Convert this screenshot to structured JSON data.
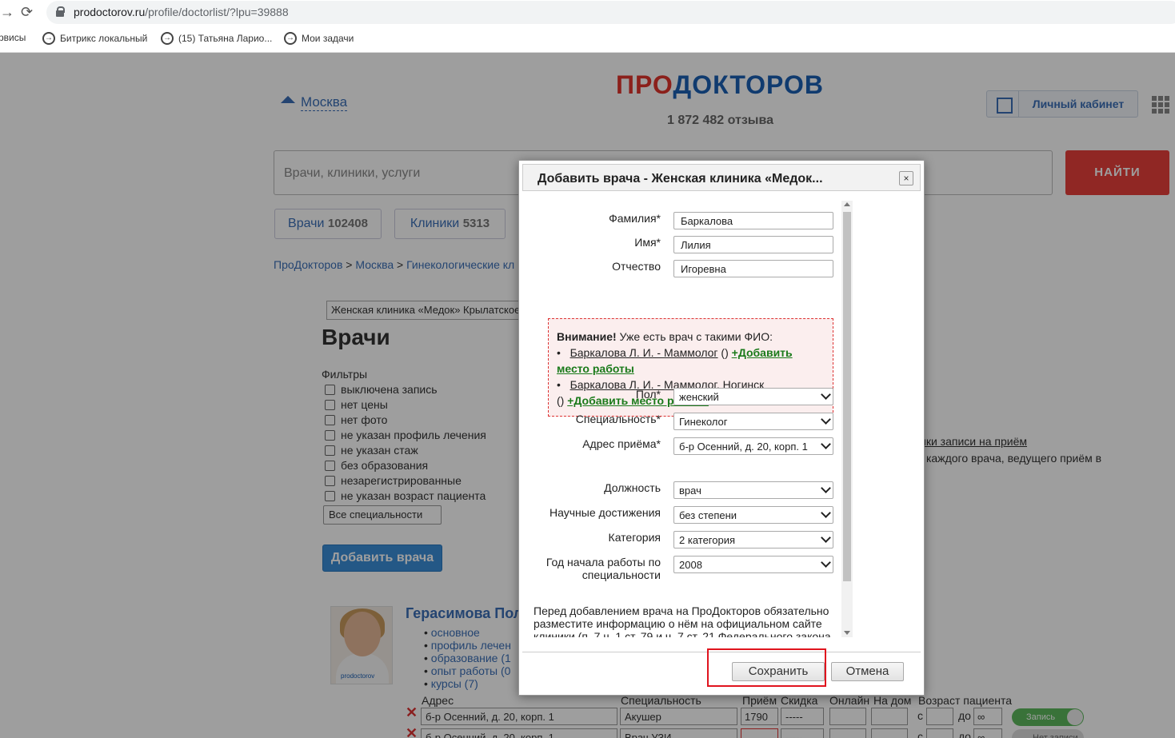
{
  "browser": {
    "url_domain": "prodoctorov.ru",
    "url_path": "/profile/doctorlist/?lpu=39888",
    "back_icon": "arrow-right-icon",
    "reload_icon": "reload-icon"
  },
  "bookmarks": [
    {
      "label": "рвисы"
    },
    {
      "label": "Битрикс локальный"
    },
    {
      "label": "(15) Татьяна Ларио..."
    },
    {
      "label": "Мои задачи"
    }
  ],
  "header": {
    "city": "Москва",
    "logo_part1": "ПРО",
    "logo_part2": "ДОКТОРОВ",
    "reviews": "1 872 482 отзыва",
    "cabinet": "Личный кабинет"
  },
  "search": {
    "placeholder": "Врачи, клиники, услуги",
    "find": "НАЙТИ"
  },
  "tabs": [
    {
      "label": "Врачи",
      "count": "102408"
    },
    {
      "label": "Клиники",
      "count": "5313"
    }
  ],
  "breadcrumbs": [
    "ПроДокторов",
    "Москва",
    "Гинекологические кл"
  ],
  "clinic_select": "Женская клиника «Медок» Крылатское",
  "heading": "Врачи",
  "filters": {
    "title": "Фильтры",
    "items": [
      "выключена запись",
      "нет цены",
      "нет фото",
      "не указан профиль лечения",
      "не указан стаж",
      "без образования",
      "незарегистрированные",
      "не указан возраст пациента"
    ],
    "specialty_select": "Все специальности"
  },
  "add_doctor_button": "Добавить врача",
  "right_info": {
    "link": "ики записи на приём",
    "text": "каждого врача, ведущего приём в"
  },
  "doctor": {
    "name": "Герасимова Пол",
    "photo_brand": "prodoctorov",
    "links": [
      "основное",
      "профиль лечен",
      "образование (1",
      "опыт работы (0",
      "курсы (7)"
    ]
  },
  "table": {
    "headers": {
      "address": "Адрес",
      "specialty": "Специальность",
      "reception": "Приём",
      "discount": "Скидка",
      "online": "Онлайн",
      "home": "На дом",
      "age": "Возраст пациента"
    },
    "rows": [
      {
        "address": "б-р Осенний, д. 20, корп. 1",
        "specialty": "Акушер",
        "price": "1790",
        "discount": "-----",
        "from": "с",
        "to": "до",
        "to_value": "∞",
        "toggle": "Запись"
      },
      {
        "address": "б-р Осенний, д. 20, корп. 1",
        "specialty": "Врач УЗИ",
        "price": "",
        "discount": "-----",
        "from": "с",
        "to": "до",
        "to_value": "∞",
        "toggle": "Нет записи"
      }
    ]
  },
  "modal": {
    "title": "Добавить врача - Женская клиника «Медок...",
    "close": "×",
    "fields": {
      "last_name_label": "Фамилия*",
      "last_name": "Баркалова",
      "first_name_label": "Имя*",
      "first_name": "Лилия",
      "patronymic_label": "Отчество",
      "patronymic": "Игоревна"
    },
    "warning": {
      "bold": "Внимание!",
      "text": " Уже есть врач с такими ФИО:",
      "item1_link": "Баркалова Л. И. - Маммолог",
      "item1_suffix": " () ",
      "item1_add": "+Добавить место работы",
      "item2_link": "Баркалова Л. И. - Маммолог, Ногинск",
      "item2_suffix": "() ",
      "item2_add": "+Добавить место работы"
    },
    "selects": {
      "gender_label": "Пол*",
      "gender": "женский",
      "specialty_label": "Специальность*",
      "specialty": "Гинеколог",
      "address_label": "Адрес приёма*",
      "address": "б-р Осенний, д. 20, корп. 1",
      "position_label": "Должность",
      "position": "врач",
      "science_label": "Научные достижения",
      "science": "без степени",
      "category_label": "Категория",
      "category": "2 категория",
      "year_label": "Год начала работы по специальности",
      "year": "2008"
    },
    "notice": "Перед добавлением врача на ПроДокторов обязательно разместите информацию о нём на официальном сайте клиники (п. 7 ч. 1 ст. 79 и ч. 7 ст. 21 Федерального закона",
    "save": "Сохранить",
    "cancel": "Отмена"
  },
  "colors": {
    "brand_red": "#e0352c",
    "brand_blue": "#1a5fb4",
    "link": "#3a6fb7",
    "highlight_box": "#e0141e"
  }
}
